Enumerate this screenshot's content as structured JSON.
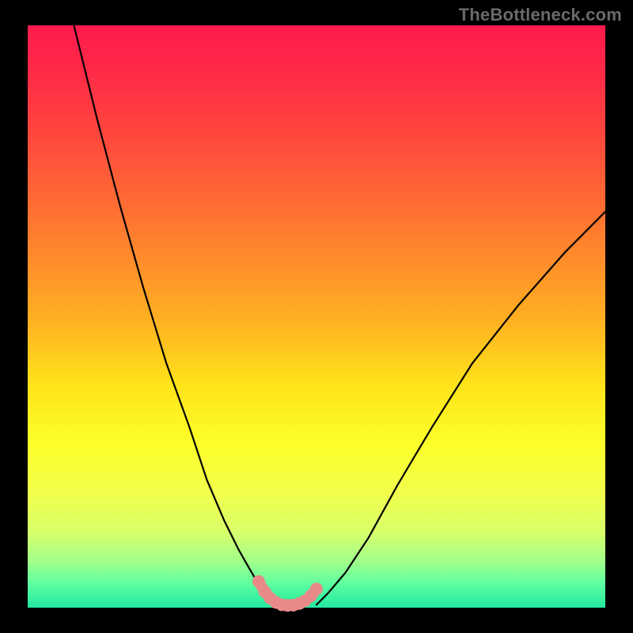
{
  "watermark": "TheBottleneck.com",
  "colors": {
    "frame": "#000000",
    "curve": "#000000",
    "marker": "#e88a8a",
    "gradient_top": "#ff1a4d",
    "gradient_bottom": "#22e8a0"
  },
  "chart_data": {
    "type": "line",
    "title": "",
    "xlabel": "",
    "ylabel": "",
    "xlim": [
      0,
      100
    ],
    "ylim": [
      0,
      100
    ],
    "series": [
      {
        "name": "left-curve",
        "x": [
          8,
          12,
          16,
          20,
          24,
          28,
          31,
          34,
          36.5,
          38.5,
          40,
          41,
          42,
          43
        ],
        "y": [
          100,
          84,
          69,
          55,
          42,
          31,
          22,
          15,
          10,
          6.5,
          4,
          2.5,
          1.3,
          0.5
        ]
      },
      {
        "name": "right-curve",
        "x": [
          50,
          52,
          55,
          59,
          64,
          70,
          77,
          85,
          93,
          100
        ],
        "y": [
          0.5,
          2.5,
          6,
          12,
          21,
          31,
          42,
          52,
          61,
          68
        ]
      },
      {
        "name": "sweet-spot-markers",
        "x": [
          40,
          41,
          42,
          43,
          44,
          45,
          46,
          47,
          48,
          49,
          50
        ],
        "y": [
          4.5,
          2.8,
          1.6,
          0.9,
          0.5,
          0.4,
          0.45,
          0.7,
          1.2,
          2.0,
          3.2
        ]
      }
    ],
    "annotations": []
  }
}
